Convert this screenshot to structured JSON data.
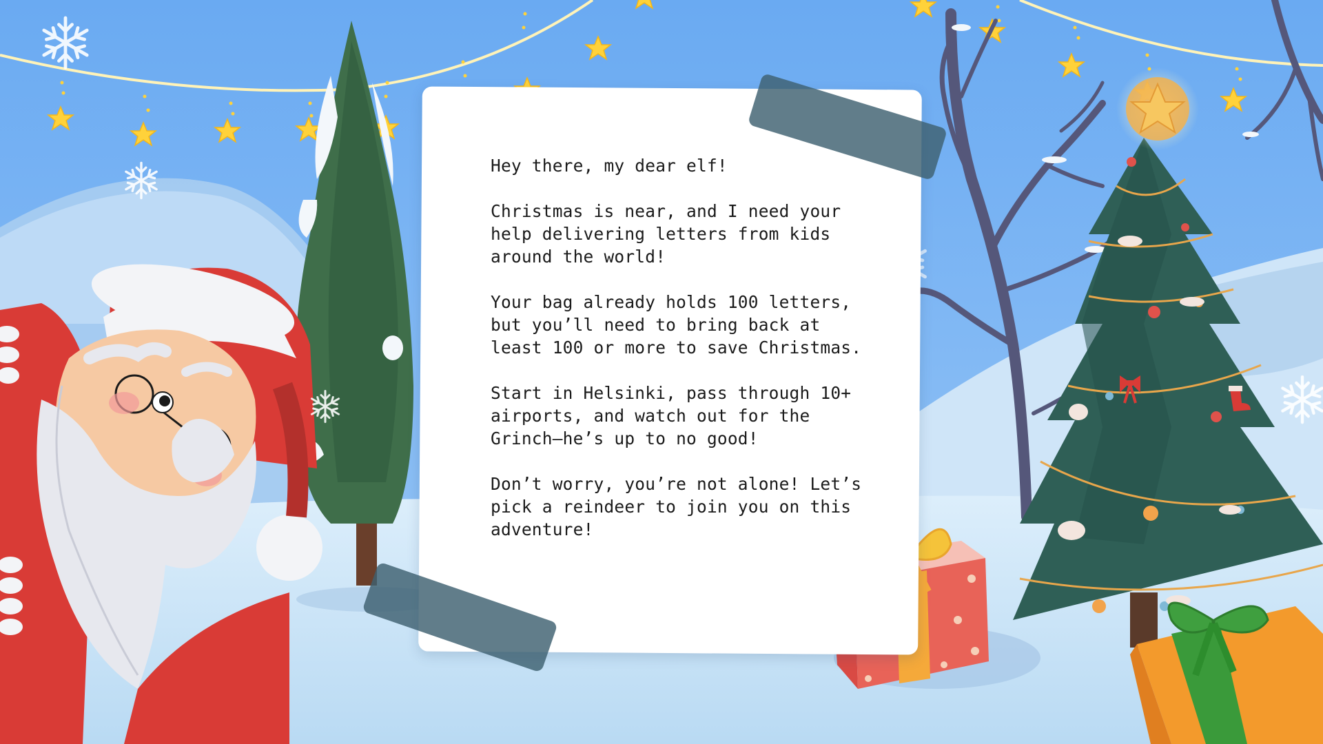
{
  "scene": {
    "colors": {
      "sky": "#6fb0f4",
      "snow": "#e6f1fb",
      "letter_paper": "#ffffff",
      "tape": "#3e6070",
      "santa_red": "#d93b36",
      "tree_green": "#2f5f56",
      "star_yellow": "#ffd23a"
    },
    "decorations": [
      "santa-claus",
      "christmas-tree",
      "pine-tree",
      "bare-tree",
      "star-garland",
      "snowflake-icon",
      "red-gift-box",
      "green-gift-box",
      "tree-top-star"
    ]
  },
  "letter": {
    "paragraphs": [
      "Hey there, my dear elf!",
      "Christmas is near, and I need your\nhelp delivering letters from kids\naround the world!",
      "Your bag already holds 100 letters,\nbut you’ll need to bring back at\nleast 100 or more to save Christmas.",
      "Start in Helsinki, pass through 10+\nairports, and watch out for the\nGrinch—he’s up to no good!",
      "Don’t worry, you’re not alone! Let’s\npick a reindeer to join you on this\nadventure!"
    ]
  }
}
